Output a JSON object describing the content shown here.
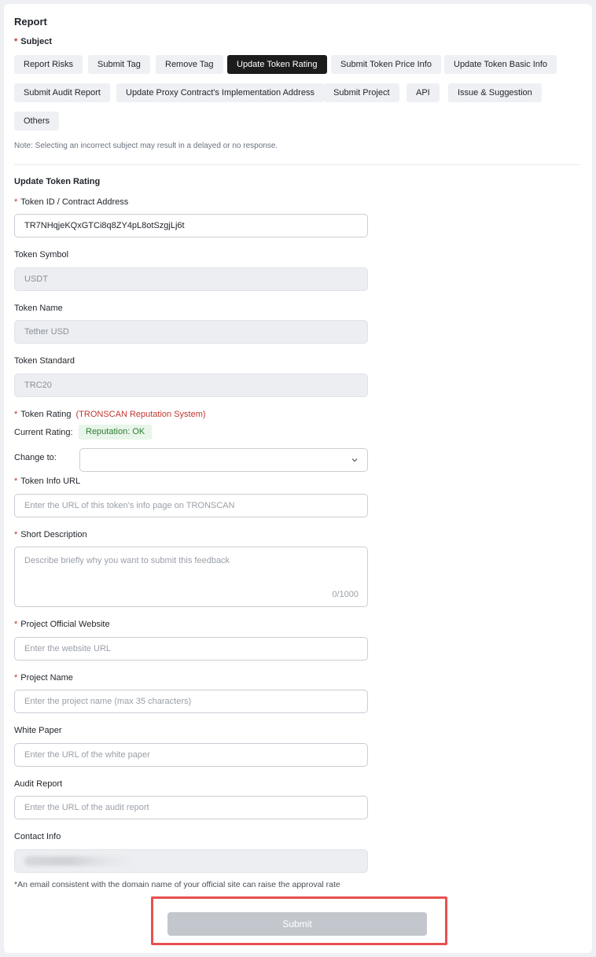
{
  "page": {
    "title": "Report",
    "subject_label": "Subject",
    "note": "Note: Selecting an incorrect subject may result in a delayed or no response."
  },
  "subjects": [
    {
      "label": "Report Risks",
      "active": false
    },
    {
      "label": "Submit Tag",
      "active": false
    },
    {
      "label": "Remove Tag",
      "active": false
    },
    {
      "label": "Update Token Rating",
      "active": true
    },
    {
      "label": "Submit Token Price Info",
      "active": false
    },
    {
      "label": "Update Token Basic Info",
      "active": false
    },
    {
      "label": "Submit Audit Report",
      "active": false
    },
    {
      "label": "Update Proxy Contract's Implementation Address",
      "active": false
    },
    {
      "label": "Submit Project",
      "active": false
    },
    {
      "label": "API",
      "active": false
    },
    {
      "label": "Issue & Suggestion",
      "active": false
    },
    {
      "label": "Others",
      "active": false
    }
  ],
  "form": {
    "section_title": "Update Token Rating",
    "token_id": {
      "label": "Token ID / Contract Address",
      "value": "TR7NHqjeKQxGTCi8q8ZY4pL8otSzgjLj6t"
    },
    "token_symbol": {
      "label": "Token Symbol",
      "value": "USDT"
    },
    "token_name": {
      "label": "Token Name",
      "value": "Tether USD"
    },
    "token_standard": {
      "label": "Token Standard",
      "value": "TRC20"
    },
    "token_rating": {
      "label": "Token Rating",
      "link": "(TRONSCAN Reputation System)",
      "current_label": "Current Rating:",
      "current_value": "Reputation: OK",
      "change_label": "Change to:",
      "change_value": ""
    },
    "token_info_url": {
      "label": "Token Info URL",
      "placeholder": "Enter the URL of this token's info page on TRONSCAN"
    },
    "short_description": {
      "label": "Short Description",
      "placeholder": "Describe briefly why you want to submit this feedback",
      "counter": "0/1000"
    },
    "official_website": {
      "label": "Project Official Website",
      "placeholder": "Enter the website URL"
    },
    "project_name": {
      "label": "Project Name",
      "placeholder": "Enter the project name (max 35 characters)"
    },
    "white_paper": {
      "label": "White Paper",
      "placeholder": "Enter the URL of the white paper"
    },
    "audit_report": {
      "label": "Audit Report",
      "placeholder": "Enter the URL of the audit report"
    },
    "contact_info": {
      "label": "Contact Info"
    },
    "hint": "*An email consistent with the domain name of your official site can raise the approval rate",
    "submit_label": "Submit"
  },
  "colors": {
    "accent_required": "#c23631",
    "active_chip": "#1c1c1c",
    "badge_ok_bg": "#e8f5e9",
    "badge_ok_text": "#2e7d32",
    "highlight_frame": "#e8504f",
    "submit_disabled": "#c3c7cd"
  },
  "icons": {
    "select_chevron": "chevron-down-icon"
  }
}
